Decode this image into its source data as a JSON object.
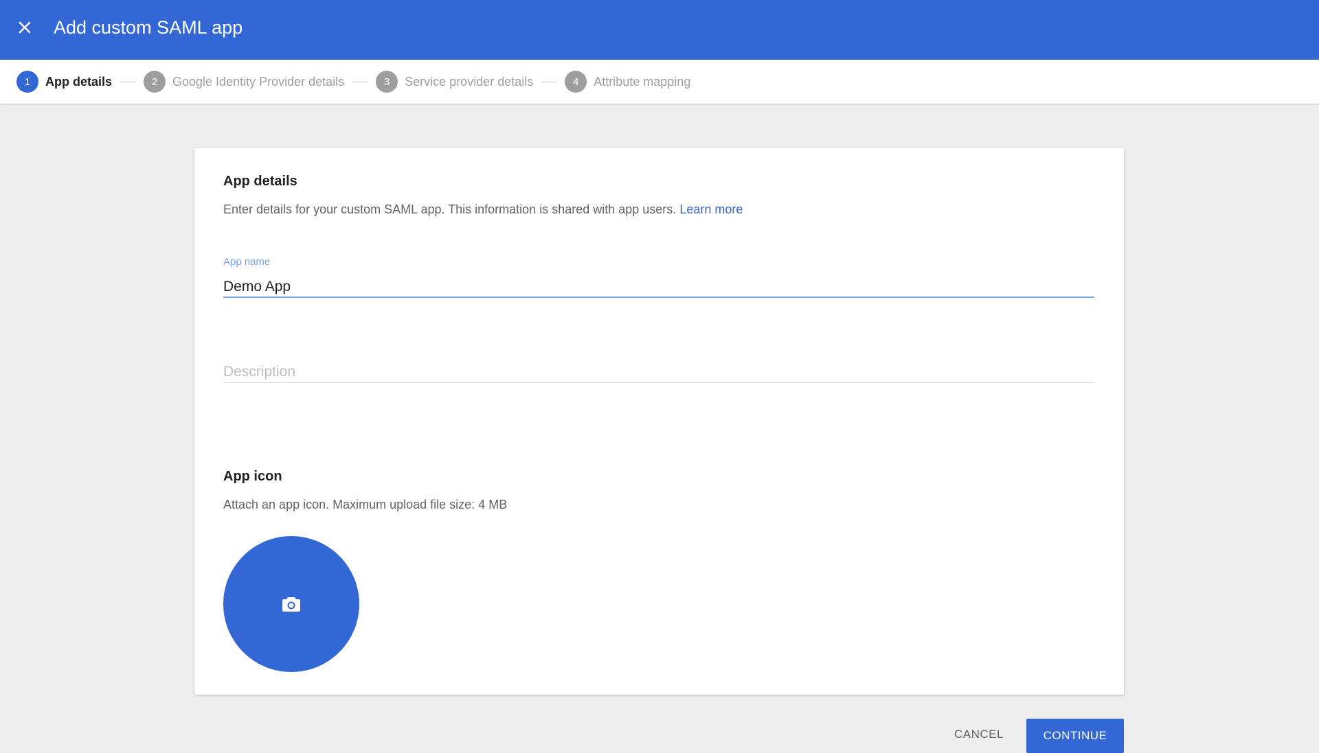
{
  "header": {
    "title": "Add custom SAML app",
    "close_icon": "close-icon"
  },
  "stepper": {
    "steps": [
      {
        "number": "1",
        "label": "App details",
        "active": true
      },
      {
        "number": "2",
        "label": "Google Identity Provider details",
        "active": false
      },
      {
        "number": "3",
        "label": "Service provider details",
        "active": false
      },
      {
        "number": "4",
        "label": "Attribute mapping",
        "active": false
      }
    ]
  },
  "app_details": {
    "title": "App details",
    "description": "Enter details for your custom SAML app. This information is shared with app users.",
    "learn_more": "Learn more",
    "app_name_label": "App name",
    "app_name_value": "Demo App",
    "description_placeholder": "Description",
    "description_value": ""
  },
  "app_icon": {
    "title": "App icon",
    "description": "Attach an app icon. Maximum upload file size: 4 MB",
    "upload_icon": "camera-icon"
  },
  "actions": {
    "cancel_label": "CANCEL",
    "continue_label": "CONTINUE"
  },
  "colors": {
    "brand": "#3367d6",
    "field_focus": "#7aa2e8",
    "background": "#eeeeee"
  }
}
